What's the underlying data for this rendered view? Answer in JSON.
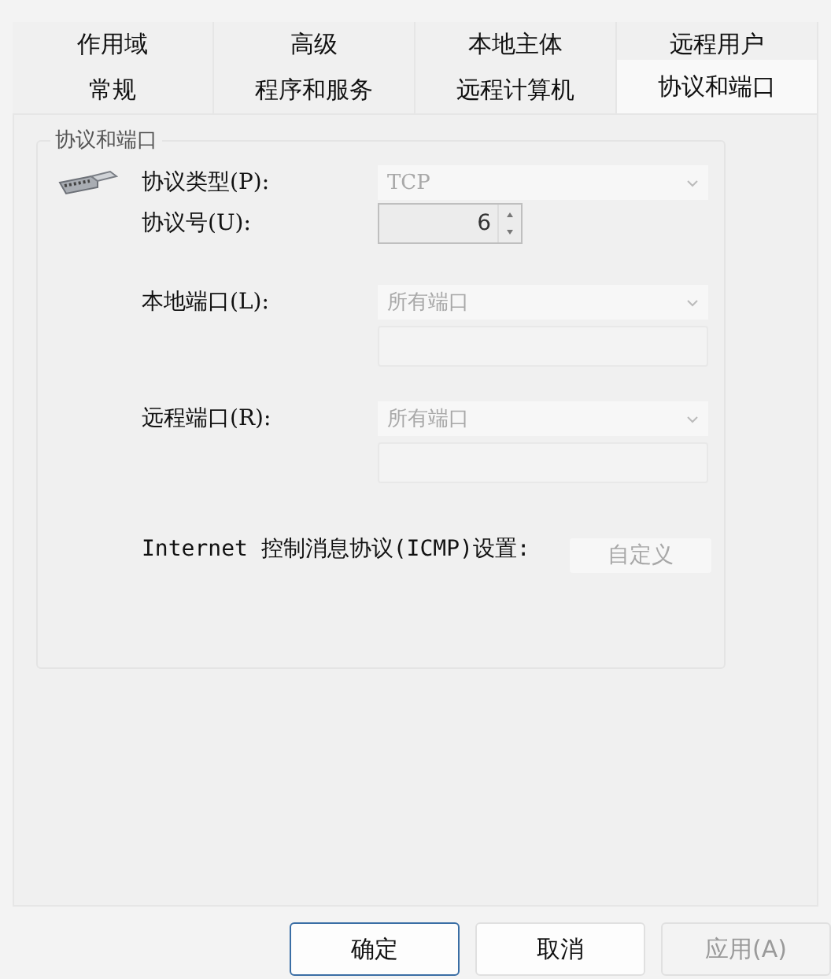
{
  "tabs": [
    [
      {
        "label": "作用域",
        "selected": false
      },
      {
        "label": "高级",
        "selected": false
      },
      {
        "label": "本地主体",
        "selected": false
      },
      {
        "label": "远程用户",
        "selected": false
      }
    ],
    [
      {
        "label": "常规",
        "selected": false
      },
      {
        "label": "程序和服务",
        "selected": false
      },
      {
        "label": "远程计算机",
        "selected": false
      },
      {
        "label": "协议和端口",
        "selected": true
      }
    ]
  ],
  "group": {
    "title": "协议和端口",
    "protocol_type": {
      "label": "协议类型(P):",
      "value": "TCP",
      "disabled": true
    },
    "protocol_number": {
      "label": "协议号(U):",
      "value": "6"
    },
    "local_port": {
      "label": "本地端口(L):",
      "value": "所有端口",
      "disabled": true
    },
    "remote_port": {
      "label": "远程端口(R):",
      "value": "所有端口",
      "disabled": true
    },
    "icmp": {
      "label": "Internet 控制消息协议(ICMP)设置:",
      "button": "自定义",
      "disabled": true
    }
  },
  "buttons": [
    {
      "label": "确定",
      "default": true,
      "disabled": false
    },
    {
      "label": "取消",
      "default": false,
      "disabled": false
    },
    {
      "label": "应用(A)",
      "default": false,
      "disabled": true
    }
  ]
}
